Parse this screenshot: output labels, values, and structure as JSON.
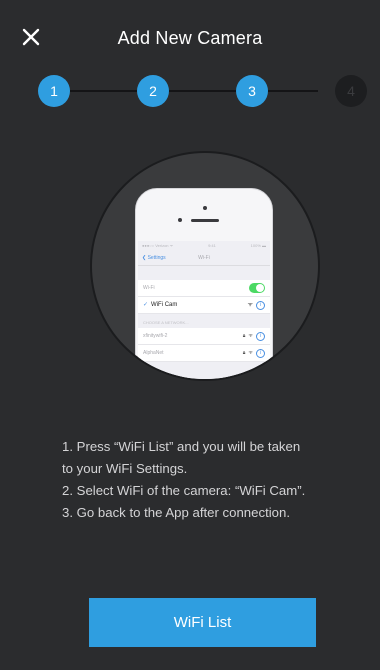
{
  "header": {
    "title": "Add New Camera",
    "close_icon": "close-icon"
  },
  "stepper": {
    "current_step": 3,
    "steps": [
      {
        "label": "1",
        "state": "active"
      },
      {
        "label": "2",
        "state": "active"
      },
      {
        "label": "3",
        "state": "active"
      },
      {
        "label": "4",
        "state": "inactive"
      }
    ]
  },
  "illustration": {
    "status_left": "●●●○○ Verizon ᯤ",
    "status_center": "9:41",
    "status_right": "100% ▬",
    "nav_back": "❮ Settings",
    "nav_title": "Wi-Fi",
    "wifi_row_label": "Wi-Fi",
    "connected_network": "WiFi Cam",
    "section_label": "CHOOSE A NETWORK...",
    "network_2": "xfinitywifi-2",
    "network_3": "AlphaNet"
  },
  "instructions": {
    "line_1": "1. Press “WiFi List” and you will be taken",
    "line_2": "to your WiFi Settings.",
    "line_3": "2. Select WiFi of the camera: “WiFi Cam”.",
    "line_4": "3. Go back to the App after connection."
  },
  "footer": {
    "button_label": "WiFi List"
  },
  "colors": {
    "background": "#2b2c2e",
    "accent": "#2f9ee0",
    "step_inactive": "#1d1e20"
  }
}
